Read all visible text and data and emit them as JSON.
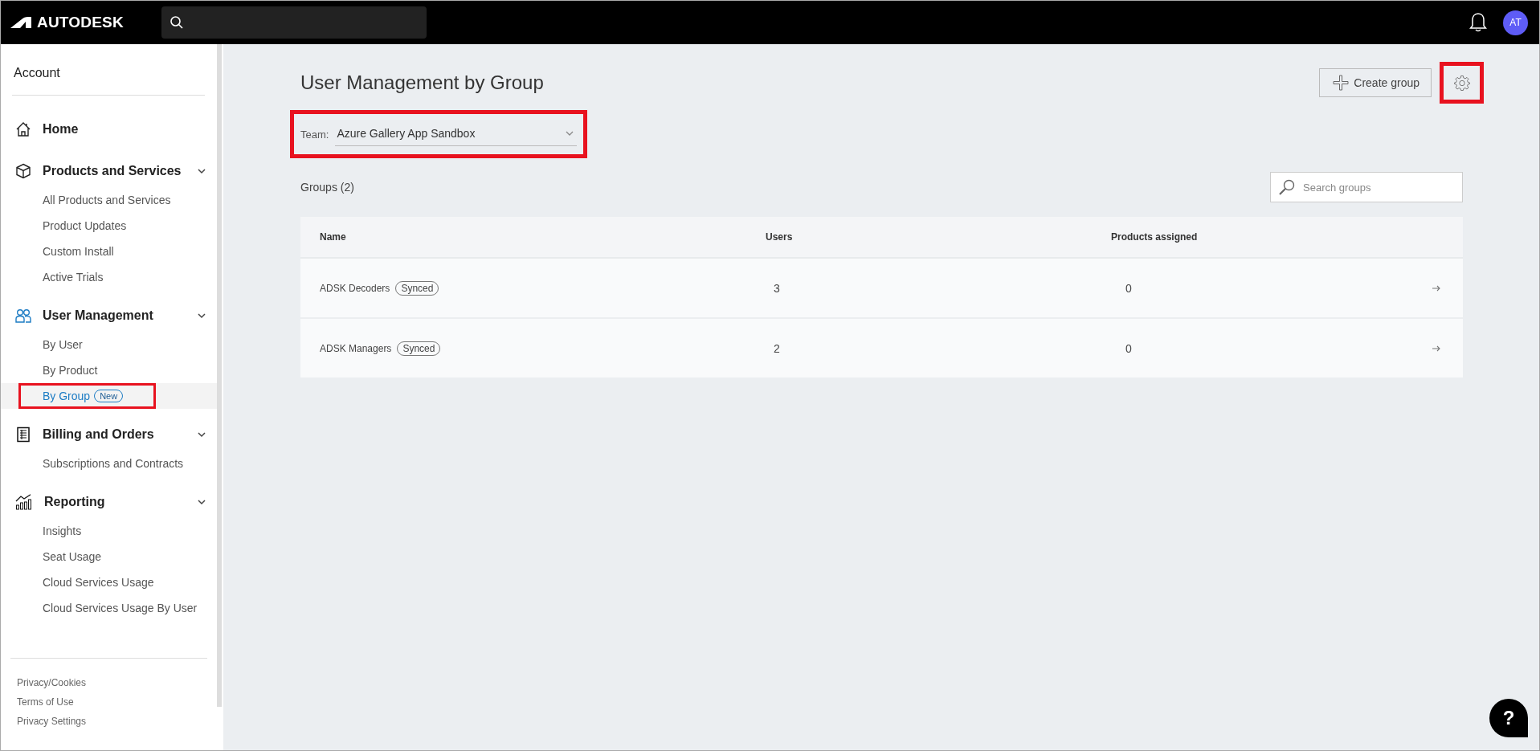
{
  "topbar": {
    "logo": "AUTODESK",
    "avatar": "AT"
  },
  "sidebar": {
    "title": "Account",
    "sections": [
      {
        "label": "Home"
      },
      {
        "label": "Products and Services",
        "expanded": true,
        "children": [
          {
            "label": "All Products and Services",
            "selected": false
          },
          {
            "label": "Product Updates",
            "selected": false
          },
          {
            "label": "Custom Install",
            "selected": false
          },
          {
            "label": "Active Trials",
            "selected": false
          }
        ]
      },
      {
        "label": "User Management",
        "expanded": true,
        "children": [
          {
            "label": "By User",
            "selected": false
          },
          {
            "label": "By Product",
            "selected": false
          },
          {
            "label": "By Group",
            "selected": true,
            "badge": "New",
            "highlighted": true
          }
        ]
      },
      {
        "label": "Billing and Orders",
        "expanded": true,
        "children": [
          {
            "label": "Subscriptions and Contracts",
            "selected": false
          }
        ]
      },
      {
        "label": "Reporting",
        "expanded": true,
        "children": [
          {
            "label": "Insights",
            "selected": false
          },
          {
            "label": "Seat Usage",
            "selected": false
          },
          {
            "label": "Cloud Services Usage",
            "selected": false
          },
          {
            "label": "Cloud Services Usage By User",
            "selected": false
          }
        ]
      }
    ],
    "footer_links": [
      "Privacy/Cookies",
      "Terms of Use",
      "Privacy Settings"
    ]
  },
  "page": {
    "title": "User Management by Group",
    "create_button": "Create group",
    "settings_highlighted": true,
    "team": {
      "label": "Team:",
      "value": "Azure Gallery App Sandbox",
      "highlighted": true
    },
    "groups_count": "Groups (2)",
    "search": {
      "placeholder": "Search groups"
    }
  },
  "table": {
    "columns": [
      "Name",
      "Users",
      "Products assigned"
    ],
    "rows": [
      {
        "name": "ADSK Decoders",
        "tag": "Synced",
        "users": "3",
        "products": "0"
      },
      {
        "name": "ADSK Managers",
        "tag": "Synced",
        "users": "2",
        "products": "0"
      }
    ]
  },
  "help": "?"
}
